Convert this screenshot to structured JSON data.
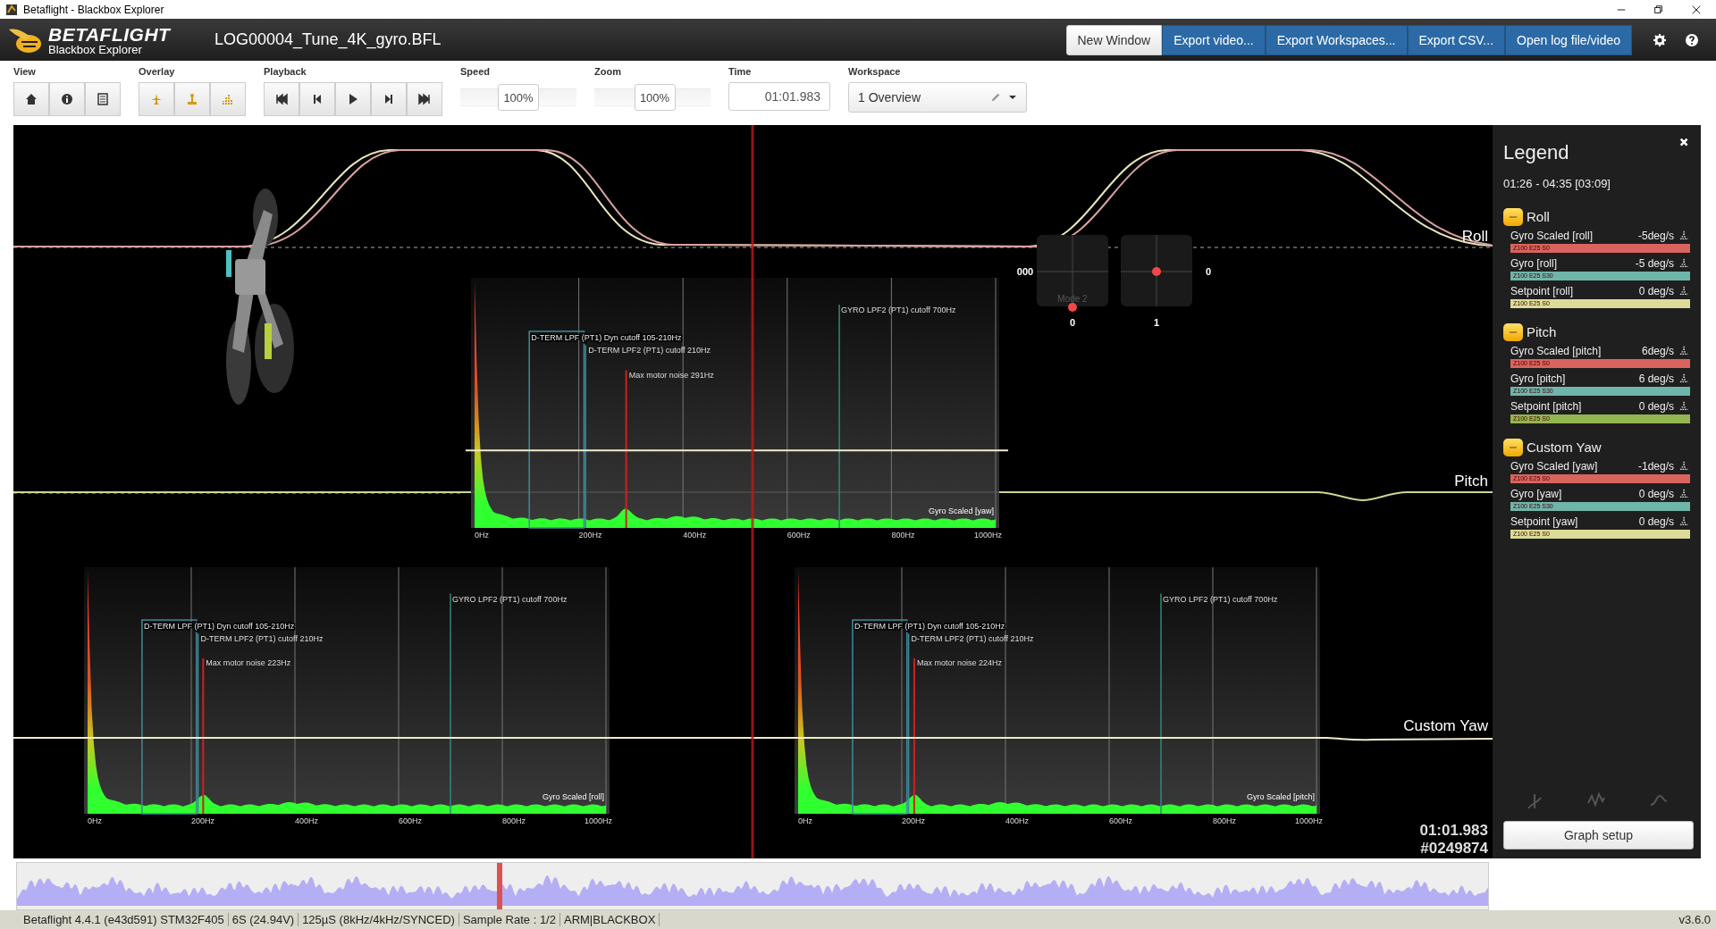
{
  "window": {
    "title": "Betaflight - Blackbox Explorer"
  },
  "header": {
    "logo_title": "BETAFLIGHT",
    "logo_subtitle": "Blackbox Explorer",
    "file_name": "LOG00004_Tune_4K_gyro.BFL",
    "buttons": [
      {
        "label": "New Window",
        "kind": "plain"
      },
      {
        "label": "Export video...",
        "kind": "primary"
      },
      {
        "label": "Export Workspaces...",
        "kind": "primary"
      },
      {
        "label": "Export CSV...",
        "kind": "primary"
      },
      {
        "label": "Open log file/video",
        "kind": "primary"
      }
    ]
  },
  "toolbar": {
    "view_label": "View",
    "overlay_label": "Overlay",
    "playback_label": "Playback",
    "speed": {
      "label": "Speed",
      "value": "100%",
      "level": 0.5
    },
    "zoom": {
      "label": "Zoom",
      "value": "100%",
      "level": 0.53
    },
    "time": {
      "label": "Time",
      "value": "01:01.983"
    },
    "workspace": {
      "label": "Workspace",
      "value": "1 Overview"
    }
  },
  "graph": {
    "traces": [
      {
        "label": "Roll"
      },
      {
        "label": "Pitch"
      },
      {
        "label": "Custom Yaw"
      }
    ],
    "spectra": [
      {
        "title": "Gyro Scaled [yaw]",
        "ticks": [
          "0Hz",
          "200Hz",
          "400Hz",
          "600Hz",
          "800Hz",
          "1000Hz"
        ],
        "annotations": [
          {
            "kind": "range",
            "label": "D-TERM LPF (PT1) Dyn cutoff 105-210Hz"
          },
          {
            "kind": "cutoff",
            "label": "D-TERM LPF2 (PT1) cutoff 210Hz"
          },
          {
            "kind": "noise",
            "label": "Max motor noise 291Hz"
          },
          {
            "kind": "gyro_cutoff",
            "label": "GYRO LPF2 (PT1) cutoff 700Hz"
          }
        ]
      },
      {
        "title": "Gyro Scaled [roll]",
        "ticks": [
          "0Hz",
          "200Hz",
          "400Hz",
          "600Hz",
          "800Hz",
          "1000Hz"
        ],
        "annotations": [
          {
            "kind": "range",
            "label": "D-TERM LPF (PT1) Dyn cutoff 105-210Hz"
          },
          {
            "kind": "cutoff",
            "label": "D-TERM LPF2 (PT1) cutoff 210Hz"
          },
          {
            "kind": "noise",
            "label": "Max motor noise 223Hz"
          },
          {
            "kind": "gyro_cutoff",
            "label": "GYRO LPF2 (PT1) cutoff 700Hz"
          }
        ]
      },
      {
        "title": "Gyro Scaled [pitch]",
        "ticks": [
          "0Hz",
          "200Hz",
          "400Hz",
          "600Hz",
          "800Hz",
          "1000Hz"
        ],
        "annotations": [
          {
            "kind": "range",
            "label": "D-TERM LPF (PT1) Dyn cutoff 105-210Hz"
          },
          {
            "kind": "cutoff",
            "label": "D-TERM LPF2 (PT1) cutoff 210Hz"
          },
          {
            "kind": "noise",
            "label": "Max motor noise 224Hz"
          },
          {
            "kind": "gyro_cutoff",
            "label": "GYRO LPF2 (PT1) cutoff 700Hz"
          }
        ]
      }
    ],
    "sticks": {
      "mode": "Mode 2",
      "left_value": "000",
      "right_value": "0",
      "left_index": "0",
      "right_index": "1"
    },
    "time": "01:01.983",
    "frame": "#0249874"
  },
  "legend": {
    "title": "Legend",
    "range": "01:26 - 04:35 [03:09]",
    "groups": [
      {
        "name": "Roll",
        "items": [
          {
            "name": "Gyro Scaled [roll]",
            "value": "-5deg/s",
            "scale": "Z100 E25 S0",
            "color": "#d9645e"
          },
          {
            "name": "Gyro [roll]",
            "value": "-5 deg/s",
            "scale": "Z100 E25 S30",
            "color": "#6fb5aa"
          },
          {
            "name": "Setpoint [roll]",
            "value": "0 deg/s",
            "scale": "Z100 E25 S0",
            "color": "#dcdc98"
          }
        ]
      },
      {
        "name": "Pitch",
        "items": [
          {
            "name": "Gyro Scaled [pitch]",
            "value": "6deg/s",
            "scale": "Z100 E25 S0",
            "color": "#d9645e"
          },
          {
            "name": "Gyro [pitch]",
            "value": "6 deg/s",
            "scale": "Z100 E25 S30",
            "color": "#6fb5aa"
          },
          {
            "name": "Setpoint [pitch]",
            "value": "0 deg/s",
            "scale": "Z100 E25 S0",
            "color": "#93b552"
          }
        ]
      },
      {
        "name": "Custom Yaw",
        "items": [
          {
            "name": "Gyro Scaled [yaw]",
            "value": "-1deg/s",
            "scale": "Z100 E25 S0",
            "color": "#d9645e"
          },
          {
            "name": "Gyro [yaw]",
            "value": "0 deg/s",
            "scale": "Z100 E25 S30",
            "color": "#6fb5aa"
          },
          {
            "name": "Setpoint [yaw]",
            "value": "0 deg/s",
            "scale": "Z100 E25 S0",
            "color": "#dcdc98"
          }
        ]
      }
    ],
    "setup_button": "Graph setup"
  },
  "status_bar": {
    "items": [
      "Betaflight 4.4.1 (e43d591) STM32F405",
      "6S (24.94V)",
      "125µS (8kHz/4kHz/SYNCED)",
      "Sample Rate : 1/2",
      "ARM|BLACKBOX"
    ],
    "version": "v3.6.0"
  }
}
